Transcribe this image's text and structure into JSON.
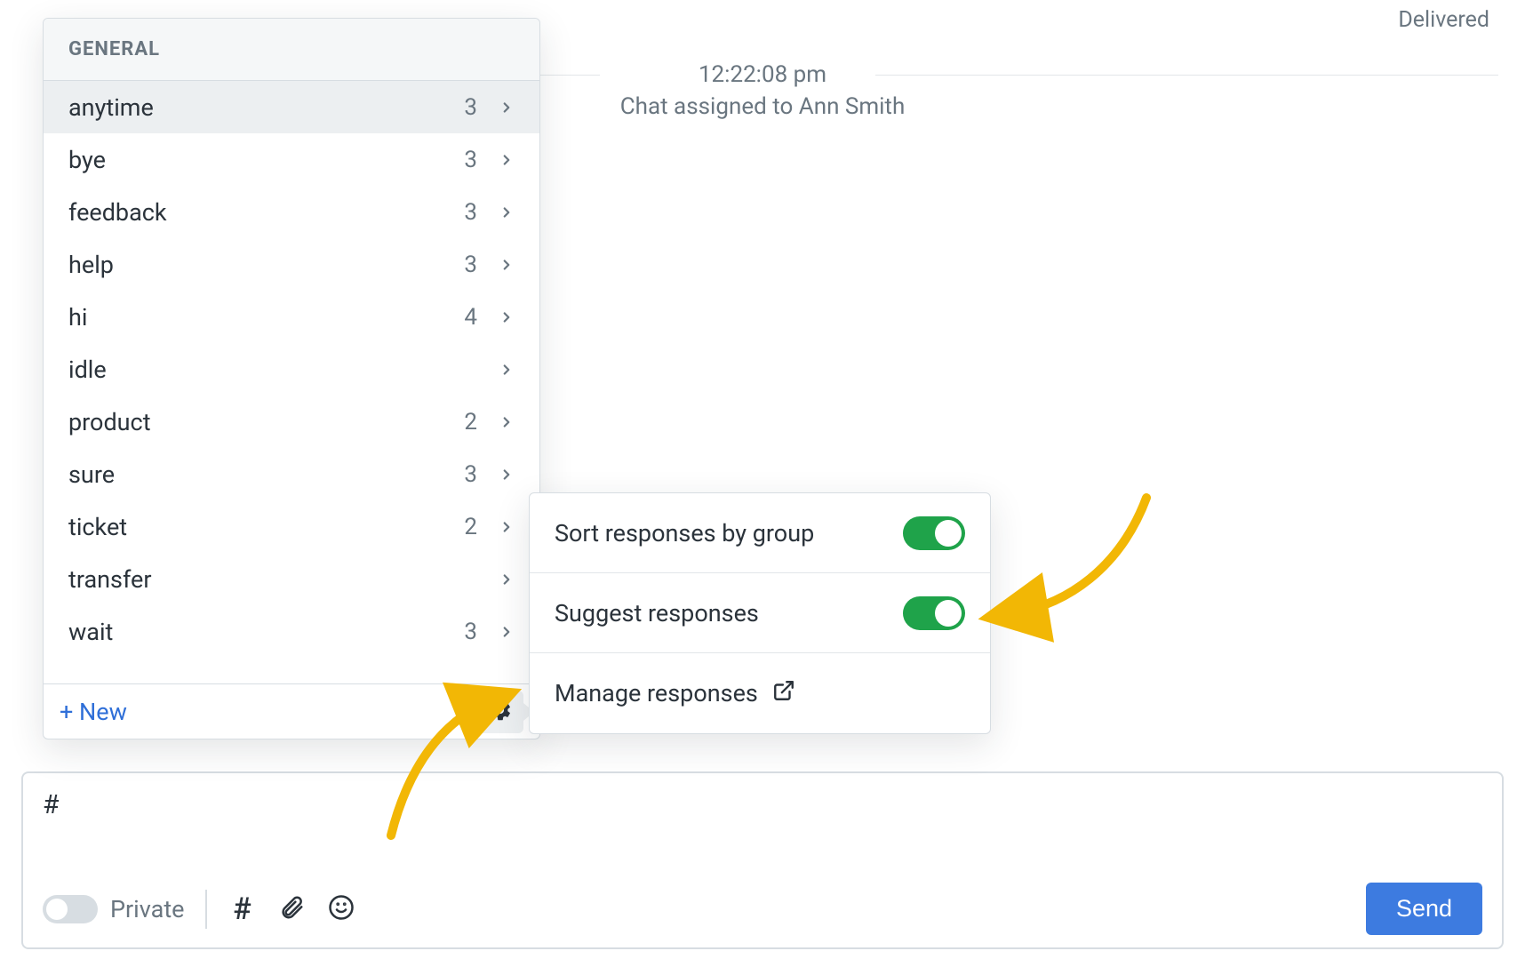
{
  "status": {
    "delivered": "Delivered"
  },
  "system": {
    "time": "12:22:08 pm",
    "message": "Chat assigned to Ann Smith"
  },
  "panel": {
    "header": "GENERAL",
    "new_label": "+ New",
    "gear_icon": "gear-icon",
    "rows": [
      {
        "label": "anytime",
        "count": "3",
        "selected": true
      },
      {
        "label": "bye",
        "count": "3",
        "selected": false
      },
      {
        "label": "feedback",
        "count": "3",
        "selected": false
      },
      {
        "label": "help",
        "count": "3",
        "selected": false
      },
      {
        "label": "hi",
        "count": "4",
        "selected": false
      },
      {
        "label": "idle",
        "count": "",
        "selected": false
      },
      {
        "label": "product",
        "count": "2",
        "selected": false
      },
      {
        "label": "sure",
        "count": "3",
        "selected": false
      },
      {
        "label": "ticket",
        "count": "2",
        "selected": false
      },
      {
        "label": "transfer",
        "count": "",
        "selected": false
      },
      {
        "label": "wait",
        "count": "3",
        "selected": false
      }
    ]
  },
  "popover": {
    "sort_label": "Sort responses by group",
    "suggest_label": "Suggest responses",
    "manage_label": "Manage responses",
    "sort_on": true,
    "suggest_on": true
  },
  "composer": {
    "text": "#",
    "private_label": "Private",
    "send_label": "Send"
  },
  "colors": {
    "accent_blue": "#3d7be0",
    "toggle_green": "#1fa34a",
    "annotation_yellow": "#f2b705",
    "muted_text": "#6a7680",
    "border": "#d7dde2"
  }
}
